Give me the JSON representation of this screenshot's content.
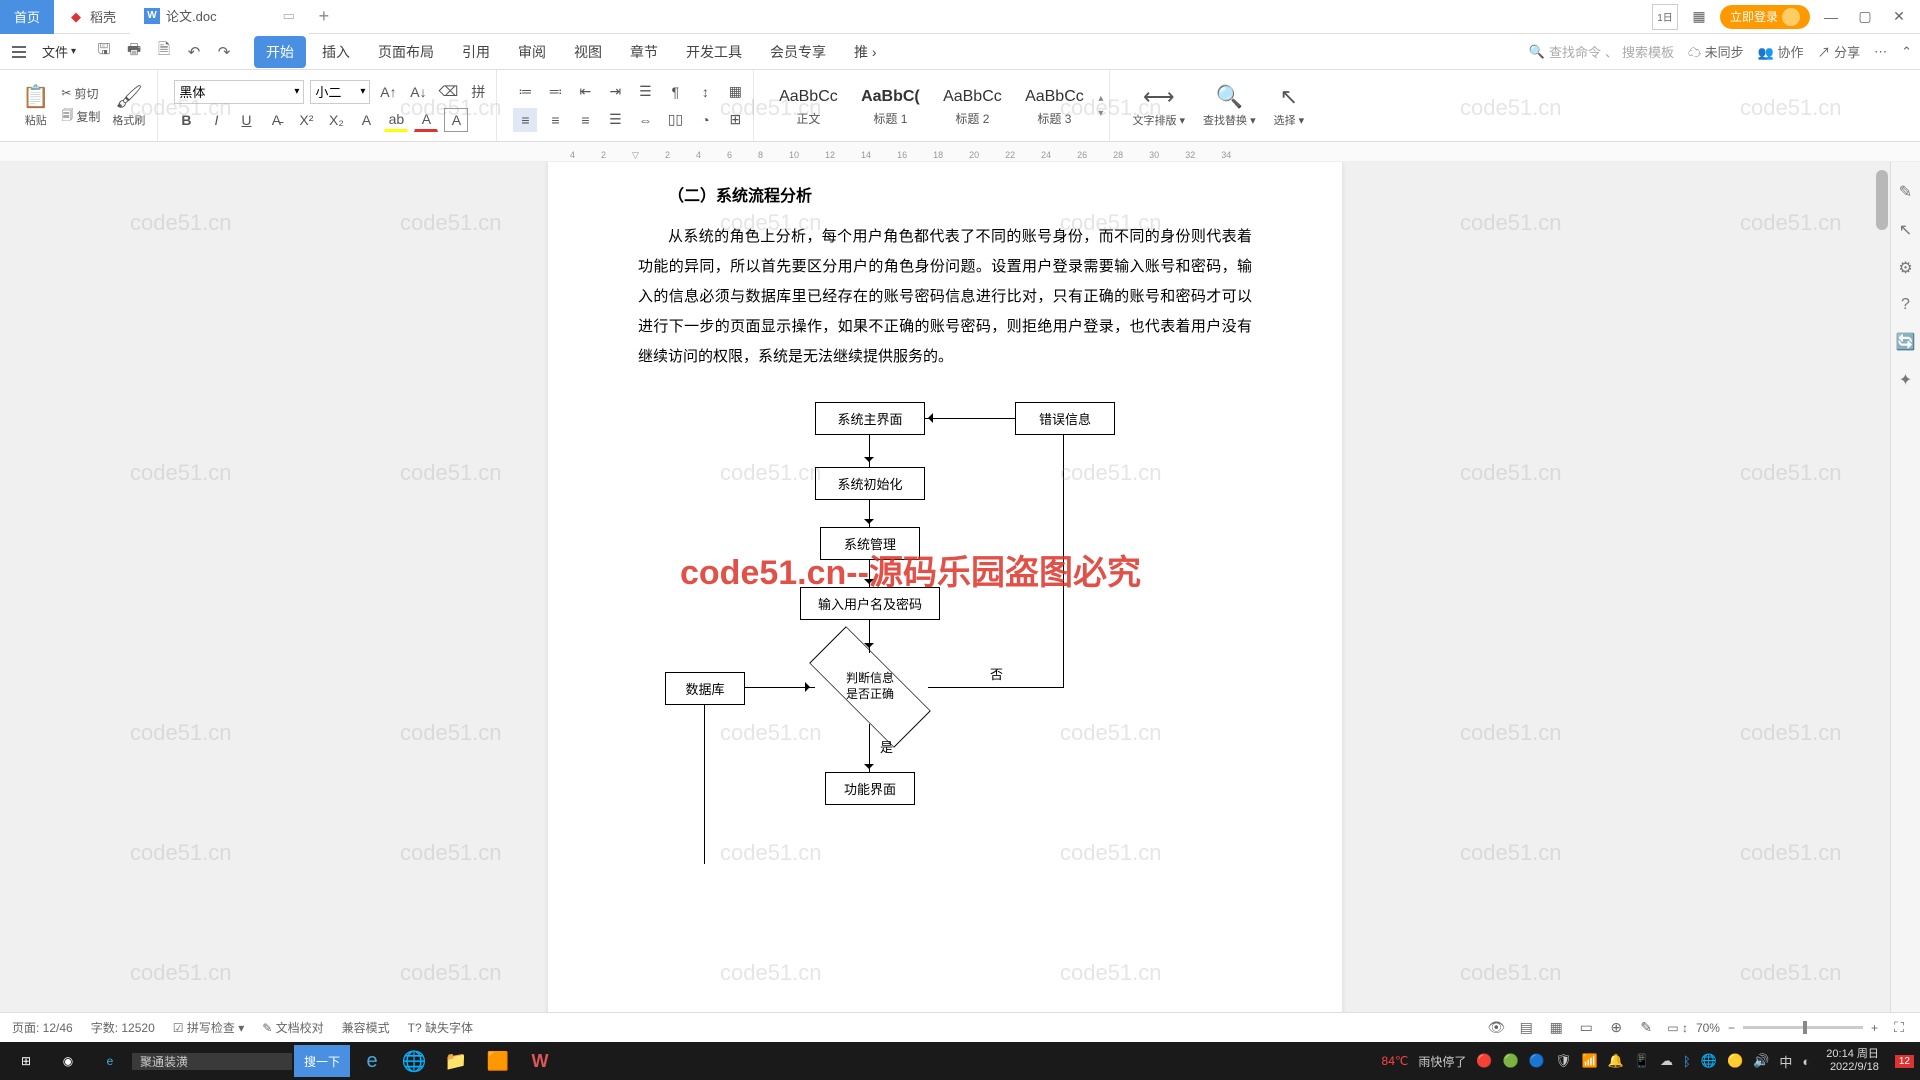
{
  "tabs": {
    "home": "首页",
    "daoke": "稻壳",
    "doc": "论文.doc"
  },
  "title_right": {
    "login": "立即登录"
  },
  "menubar": {
    "file": "文件",
    "tabs": [
      "开始",
      "插入",
      "页面布局",
      "引用",
      "审阅",
      "视图",
      "章节",
      "开发工具",
      "会员专享",
      "推"
    ],
    "search_cmd": "查找命令",
    "search_tpl": "搜索模板",
    "unsync": "未同步",
    "collab": "协作",
    "share": "分享"
  },
  "ribbon": {
    "paste": "粘贴",
    "cut": "剪切",
    "copy": "复制",
    "format_painter": "格式刷",
    "font_family": "黑体",
    "font_size": "小二",
    "styles": [
      {
        "prev": "AaBbCc",
        "name": "正文"
      },
      {
        "prev": "AaBbC(",
        "name": "标题 1"
      },
      {
        "prev": "AaBbCc",
        "name": "标题 2"
      },
      {
        "prev": "AaBbCc",
        "name": "标题 3"
      }
    ],
    "text_layout": "文字排版",
    "find_replace": "查找替换",
    "select": "选择"
  },
  "doc": {
    "heading": "（二）系统流程分析",
    "para": "从系统的角色上分析，每个用户角色都代表了不同的账号身份，而不同的身份则代表着功能的异同，所以首先要区分用户的角色身份问题。设置用户登录需要输入账号和密码，输入的信息必须与数据库里已经存在的账号密码信息进行比对，只有正确的账号和密码才可以进行下一步的页面显示操作，如果不正确的账号密码，则拒绝用户登录，也代表着用户没有继续访问的权限，系统是无法继续提供服务的。",
    "flow": {
      "main": "系统主界面",
      "err": "错误信息",
      "init": "系统初始化",
      "mgmt": "系统管理",
      "input": "输入用户名及密码",
      "db": "数据库",
      "judge": "判断信息\n是否正确",
      "yes": "是",
      "no": "否",
      "func": "功能界面"
    }
  },
  "watermark": "code51.cn",
  "big_watermark": "code51.cn--源码乐园盗图必究",
  "status": {
    "page": "页面: 12/46",
    "words": "字数: 12520",
    "spell": "拼写检查",
    "proof": "文档校对",
    "compat": "兼容模式",
    "missing_font": "缺失字体",
    "zoom": "70%"
  },
  "taskbar": {
    "search_ph": "聚通装潢",
    "search_btn": "搜一下",
    "weather_temp": "84℃",
    "weather": "雨快停了",
    "time": "20:14 周日",
    "date": "2022/9/18",
    "notif": "12"
  }
}
